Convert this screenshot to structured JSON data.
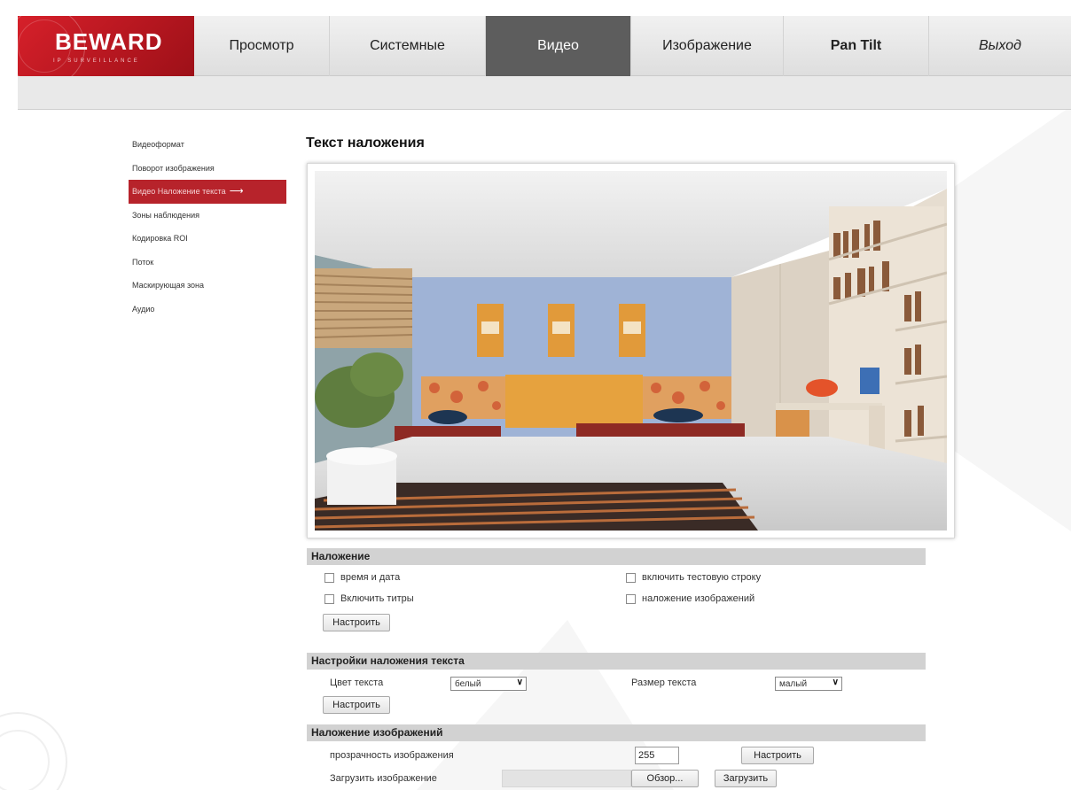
{
  "logo": {
    "text": "BEWARD",
    "subtitle": "IP SURVEILLANCE"
  },
  "nav": [
    {
      "label": "Просмотр",
      "active": false
    },
    {
      "label": "Системные",
      "active": false
    },
    {
      "label": "Видео",
      "active": true
    },
    {
      "label": "Изображение",
      "active": false
    },
    {
      "label": "Pan Tilt",
      "active": false
    },
    {
      "label": "Выход",
      "active": false
    }
  ],
  "sidebar": {
    "items": [
      {
        "label": "Видеоформат"
      },
      {
        "label": "Поворот изображения"
      },
      {
        "label": "Видео Наложение текста",
        "active": true,
        "arrow": "⟶"
      },
      {
        "label": "Зоны наблюдения"
      },
      {
        "label": "Кодировка ROI"
      },
      {
        "label": "Поток"
      },
      {
        "label": "Маскирующая зона"
      },
      {
        "label": "Аудио"
      }
    ]
  },
  "main": {
    "title": "Текст наложения",
    "overlay": {
      "header": "Наложение",
      "time_date": "время и дата",
      "test_string": "включить тестовую строку",
      "captions": "Включить титры",
      "image_overlay": "наложение изображений",
      "configure": "Настроить"
    },
    "text_settings": {
      "header": "Настройки наложения текста",
      "color_label": "Цвет текста",
      "color_value": "белый",
      "size_label": "Размер текста",
      "size_value": "малый",
      "configure": "Настроить"
    },
    "image_overlay": {
      "header": "Наложение изображений",
      "transparency_label": "прозрачность изображения",
      "transparency_value": "255",
      "configure": "Настроить",
      "upload_label": "Загрузить изображение",
      "browse": "Обзор...",
      "upload": "Загрузить"
    }
  },
  "colors": {
    "brand_red": "#c41e27",
    "active_tab": "#5d5d5d",
    "section_bar": "#d2d2d2"
  }
}
